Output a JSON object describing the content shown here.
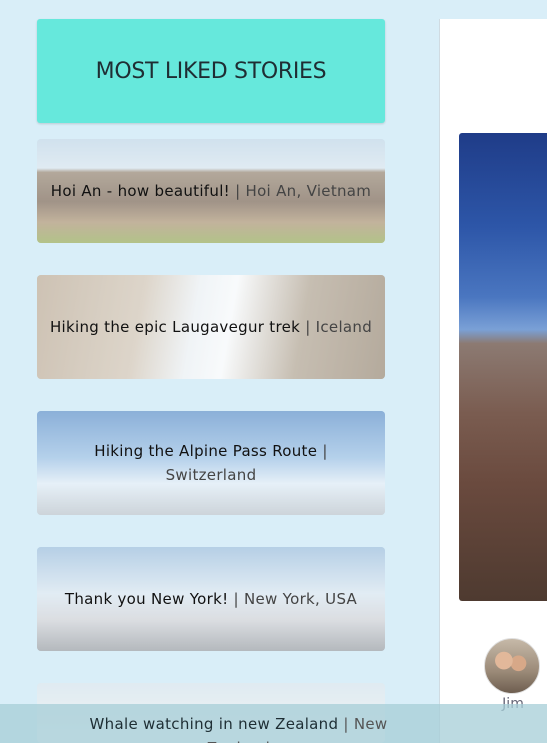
{
  "header": {
    "title": "MOST LIKED STORIES"
  },
  "stories": [
    {
      "title": "Hoi An - how beautiful!",
      "sep": "|",
      "place": "Hoi An, Vietnam"
    },
    {
      "title": "Hiking the epic Laugavegur trek",
      "sep": "|",
      "place": "Iceland"
    },
    {
      "title": "Hiking the Alpine Pass Route",
      "sep": "|",
      "place": "Switzerland"
    },
    {
      "title": "Thank you New York!",
      "sep": "|",
      "place": "New York, USA"
    },
    {
      "title": "Whale watching in new Zealand",
      "sep": "|",
      "place": "New Zealand"
    }
  ],
  "profile": {
    "name": "Jim"
  }
}
